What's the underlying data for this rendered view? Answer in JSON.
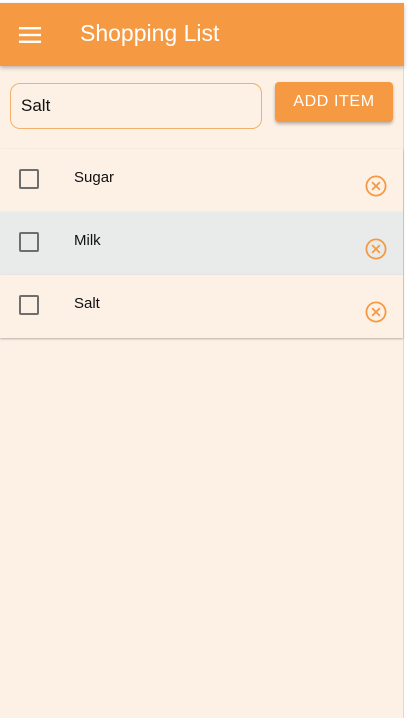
{
  "appbar": {
    "title": "Shopping List",
    "menu_icon": "hamburger-menu-icon",
    "background": "#f59a42"
  },
  "entry": {
    "value": "Salt",
    "placeholder": "",
    "add_button_label": "ADD ITEM"
  },
  "items": [
    {
      "label": "Sugar",
      "checked": false,
      "highlighted": false,
      "delete_icon": "remove-circle-icon"
    },
    {
      "label": "Milk",
      "checked": false,
      "highlighted": true,
      "delete_icon": "remove-circle-icon"
    },
    {
      "label": "Salt",
      "checked": false,
      "highlighted": false,
      "delete_icon": "remove-circle-icon"
    }
  ],
  "colors": {
    "accent": "#f59a42",
    "background": "#fdf1e6",
    "row_highlight": "#e9ebeb"
  }
}
